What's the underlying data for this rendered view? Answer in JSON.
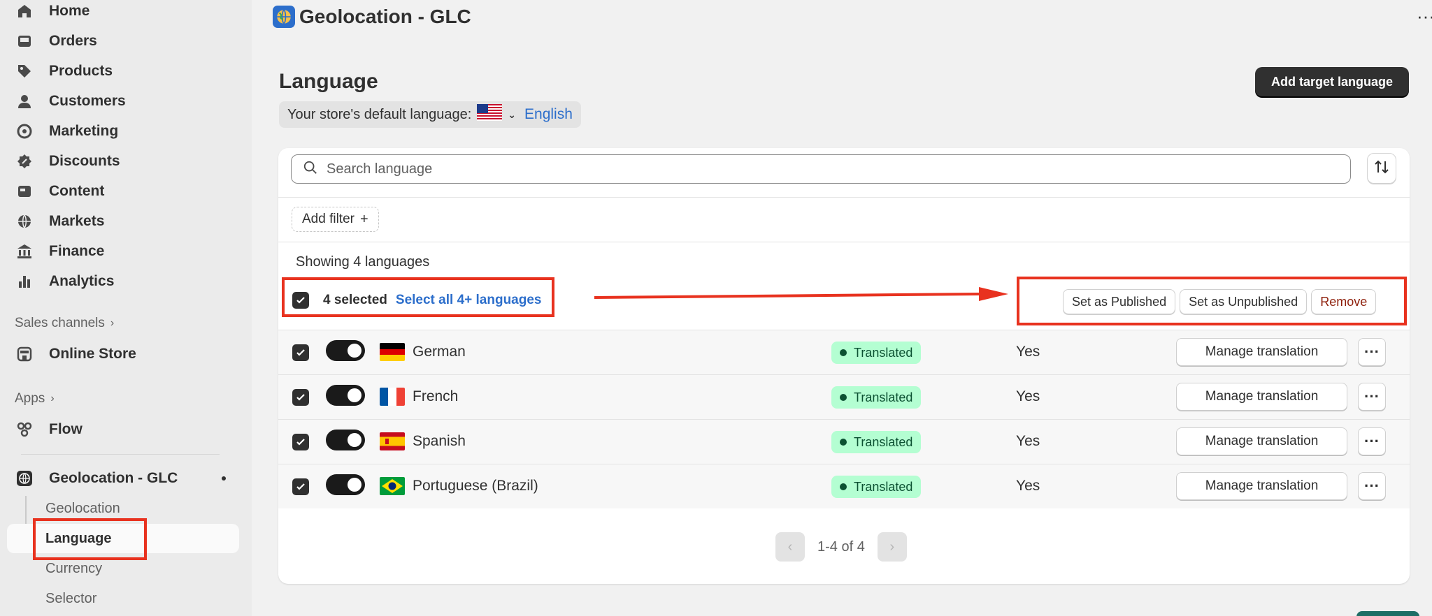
{
  "sidebar": {
    "nav": [
      {
        "label": "Home",
        "icon": "home-icon"
      },
      {
        "label": "Orders",
        "icon": "inbox-icon"
      },
      {
        "label": "Products",
        "icon": "tag-icon"
      },
      {
        "label": "Customers",
        "icon": "person-icon"
      },
      {
        "label": "Marketing",
        "icon": "target-icon"
      },
      {
        "label": "Discounts",
        "icon": "discount-icon"
      },
      {
        "label": "Content",
        "icon": "content-icon"
      },
      {
        "label": "Markets",
        "icon": "globe-icon"
      },
      {
        "label": "Finance",
        "icon": "bank-icon"
      },
      {
        "label": "Analytics",
        "icon": "bar-chart-icon"
      }
    ],
    "sales_channels_label": "Sales channels",
    "online_store": "Online Store",
    "apps_label": "Apps",
    "flow": "Flow",
    "app_name": "Geolocation - GLC",
    "app_sub_items": [
      "Geolocation",
      "Language",
      "Currency",
      "Selector"
    ],
    "active_sub_item": "Language"
  },
  "header": {
    "app_title": "Geolocation - GLC",
    "more_icon": "ellipsis-icon"
  },
  "page": {
    "title": "Language",
    "add_button": "Add target language",
    "default_language_label": "Your store's default language:",
    "default_language_value": "English"
  },
  "search": {
    "placeholder": "Search language"
  },
  "filter": {
    "add_filter_label": "Add filter"
  },
  "summary": {
    "showing_text": "Showing 4 languages",
    "selected_text": "4 selected",
    "select_all_text": "Select all 4+ languages"
  },
  "bulk_actions": {
    "publish": "Set as Published",
    "unpublish": "Set as Unpublished",
    "remove": "Remove"
  },
  "languages": [
    {
      "name": "German",
      "status": "Translated",
      "published": "Yes",
      "action": "Manage translation",
      "flag": "de"
    },
    {
      "name": "French",
      "status": "Translated",
      "published": "Yes",
      "action": "Manage translation",
      "flag": "fr"
    },
    {
      "name": "Spanish",
      "status": "Translated",
      "published": "Yes",
      "action": "Manage translation",
      "flag": "es"
    },
    {
      "name": "Portuguese (Brazil)",
      "status": "Translated",
      "published": "Yes",
      "action": "Manage translation",
      "flag": "br"
    }
  ],
  "pagination": {
    "label": "1-4 of 4"
  },
  "colors": {
    "annotation_red": "#e8321f",
    "link_blue": "#2c6ecb",
    "badge_green_bg": "#b4fed2",
    "badge_green_text": "#0c5132",
    "primary_button": "#303030"
  }
}
